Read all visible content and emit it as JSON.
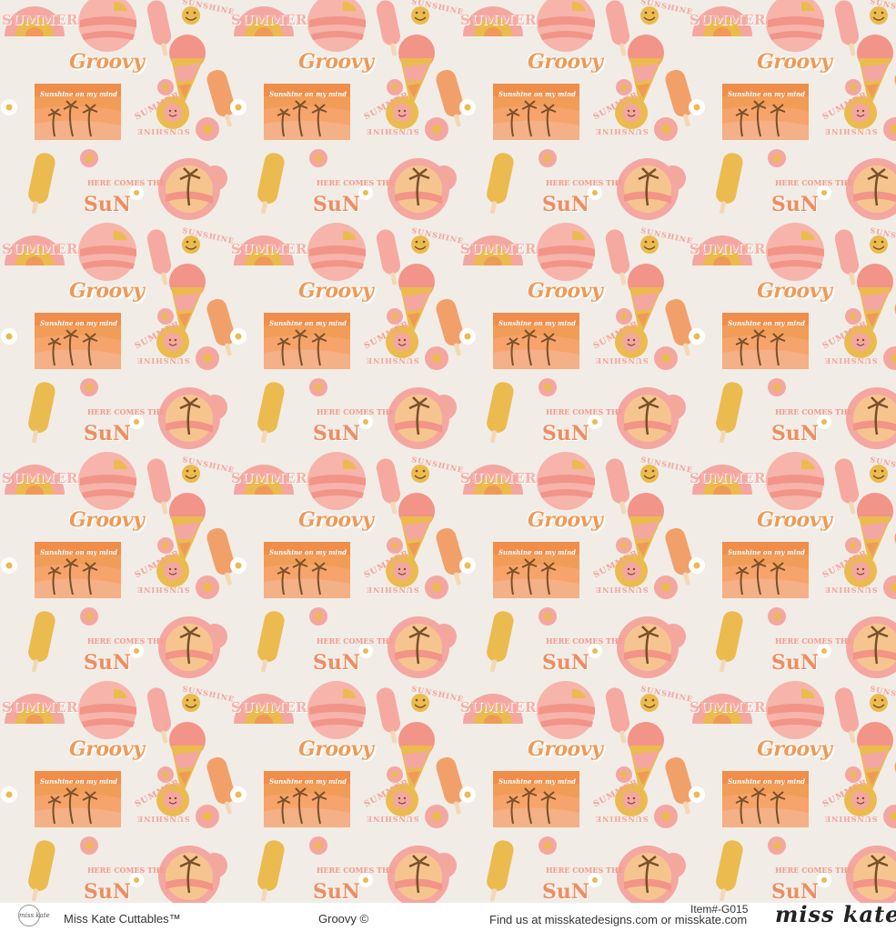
{
  "pattern": {
    "words": {
      "summer": "SUMMER",
      "sunshine": "SUNSHINE",
      "groovy": "Groovy",
      "sunshine_on_my_mind": "Sunshine on my mind",
      "summer_arc": "SUMMER",
      "sunshine_arc": "SUNSHINE",
      "here_comes_the": "HERE COMES THE",
      "sun": "SuN"
    },
    "colors": {
      "background": "#f1ece6",
      "pink": "#f4a7a0",
      "orange": "#ef9a56",
      "yellow": "#ebbb4f",
      "brown": "#7a5028",
      "white": "#ffffff"
    },
    "motifs": [
      "sun-arc-sticker",
      "smiley-icon",
      "ice-pop-icon",
      "snow-cone-icon",
      "palm-sunset-sign",
      "daisy-icon",
      "smiley-flower-icon",
      "palm-circle-icon"
    ]
  },
  "footer": {
    "logo": "miss kate",
    "brand": "Miss Kate Cuttables™",
    "title": "Groovy ©",
    "item": "Item#-G015",
    "find": "Find us at misskatedesigns.com or misskate.com",
    "script": "miss kate"
  }
}
